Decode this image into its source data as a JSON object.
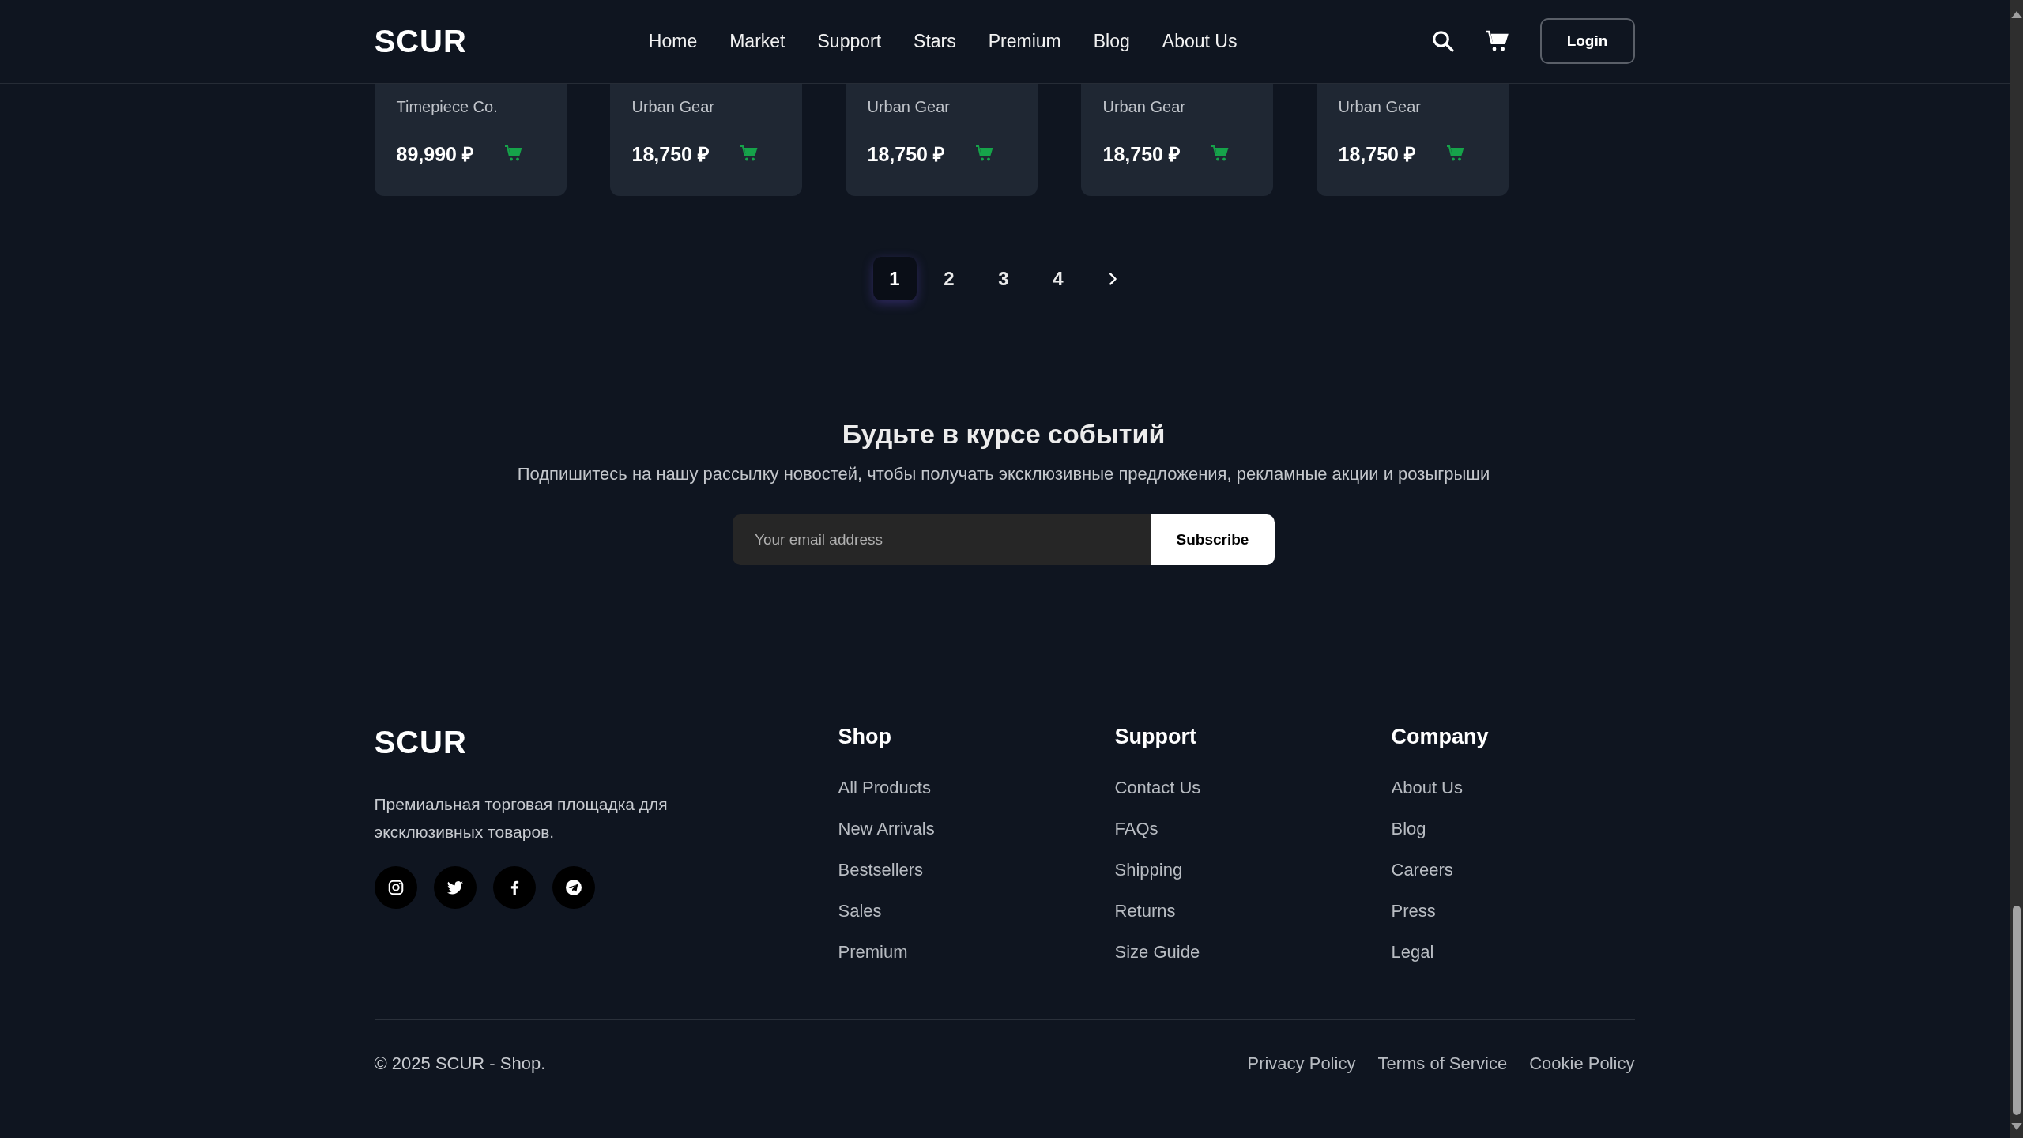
{
  "header": {
    "logo": "SCUR",
    "nav": [
      {
        "label": "Home"
      },
      {
        "label": "Market"
      },
      {
        "label": "Support"
      },
      {
        "label": "Stars"
      },
      {
        "label": "Premium"
      },
      {
        "label": "Blog"
      },
      {
        "label": "About Us"
      }
    ],
    "login": "Login"
  },
  "products": [
    {
      "brand": "Timepiece Co.",
      "price": "89,990 ₽"
    },
    {
      "brand": "Urban Gear",
      "price": "18,750 ₽"
    },
    {
      "brand": "Urban Gear",
      "price": "18,750 ₽"
    },
    {
      "brand": "Urban Gear",
      "price": "18,750 ₽"
    },
    {
      "brand": "Urban Gear",
      "price": "18,750 ₽"
    }
  ],
  "pagination": {
    "pages": [
      {
        "label": "1",
        "selected": true
      },
      {
        "label": "2",
        "selected": false
      },
      {
        "label": "3",
        "selected": false
      },
      {
        "label": "4",
        "selected": false
      }
    ]
  },
  "newsletter": {
    "title": "Будьте в курсе событий",
    "subtitle": "Подпишитесь на нашу рассылку новостей, чтобы получать эксклюзивные предложения, рекламные акции и розыгрыши",
    "placeholder": "Your email address",
    "button": "Subscribe"
  },
  "footer": {
    "logo": "SCUR",
    "description": "Премиальная торговая площадка для эксклюзивных товаров.",
    "social": [
      {
        "kind": "instagram"
      },
      {
        "kind": "twitter"
      },
      {
        "kind": "facebook"
      },
      {
        "kind": "telegram"
      }
    ],
    "columns": [
      {
        "title": "Shop",
        "links": [
          "All Products",
          "New Arrivals",
          "Bestsellers",
          "Sales",
          "Premium"
        ]
      },
      {
        "title": "Support",
        "links": [
          "Contact Us",
          "FAQs",
          "Shipping",
          "Returns",
          "Size Guide"
        ]
      },
      {
        "title": "Company",
        "links": [
          "About Us",
          "Blog",
          "Careers",
          "Press",
          "Legal"
        ]
      }
    ],
    "copyright": "© 2025 SCUR - Shop.",
    "legal": [
      "Privacy Policy",
      "Terms of Service",
      "Cookie Policy"
    ]
  }
}
